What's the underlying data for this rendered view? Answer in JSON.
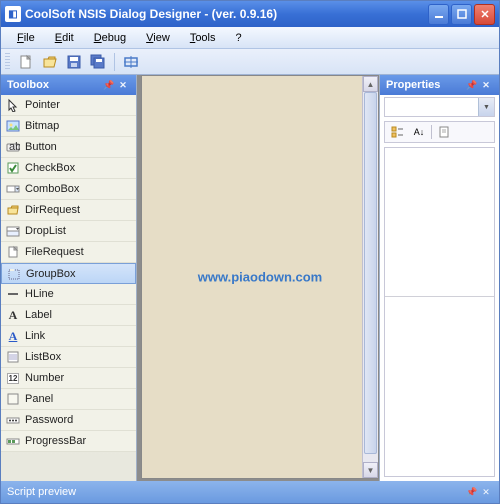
{
  "titlebar": {
    "title": "CoolSoft NSIS Dialog Designer - (ver. 0.9.16)"
  },
  "menubar": {
    "items": [
      {
        "label": "File",
        "accel": "F"
      },
      {
        "label": "Edit",
        "accel": "E"
      },
      {
        "label": "Debug",
        "accel": "D"
      },
      {
        "label": "View",
        "accel": "V"
      },
      {
        "label": "Tools",
        "accel": "T"
      },
      {
        "label": "?",
        "accel": "?"
      }
    ]
  },
  "toolbar": {
    "buttons": [
      {
        "name": "new-icon"
      },
      {
        "name": "open-icon"
      },
      {
        "name": "save-icon"
      },
      {
        "name": "save-all-icon"
      },
      {
        "sep": true
      },
      {
        "name": "resize-icon"
      }
    ]
  },
  "toolbox": {
    "title": "Toolbox",
    "items": [
      {
        "icon": "cursor-icon",
        "label": "Pointer",
        "selected": false
      },
      {
        "icon": "bitmap-icon",
        "label": "Bitmap",
        "selected": false
      },
      {
        "icon": "button-icon",
        "label": "Button",
        "selected": false
      },
      {
        "icon": "checkbox-icon",
        "label": "CheckBox",
        "selected": false
      },
      {
        "icon": "combobox-icon",
        "label": "ComboBox",
        "selected": false
      },
      {
        "icon": "dirrequest-icon",
        "label": "DirRequest",
        "selected": false
      },
      {
        "icon": "droplist-icon",
        "label": "DropList",
        "selected": false
      },
      {
        "icon": "filerequest-icon",
        "label": "FileRequest",
        "selected": false
      },
      {
        "icon": "groupbox-icon",
        "label": "GroupBox",
        "selected": true
      },
      {
        "icon": "hline-icon",
        "label": "HLine",
        "selected": false
      },
      {
        "icon": "label-icon",
        "label": "Label",
        "selected": false
      },
      {
        "icon": "link-icon",
        "label": "Link",
        "selected": false
      },
      {
        "icon": "listbox-icon",
        "label": "ListBox",
        "selected": false
      },
      {
        "icon": "number-icon",
        "label": "Number",
        "selected": false
      },
      {
        "icon": "panel-icon",
        "label": "Panel",
        "selected": false
      },
      {
        "icon": "password-icon",
        "label": "Password",
        "selected": false
      },
      {
        "icon": "progressbar-icon",
        "label": "ProgressBar",
        "selected": false
      }
    ]
  },
  "properties": {
    "title": "Properties"
  },
  "script_preview": {
    "title": "Script preview"
  },
  "watermark": "www.piaodown.com"
}
